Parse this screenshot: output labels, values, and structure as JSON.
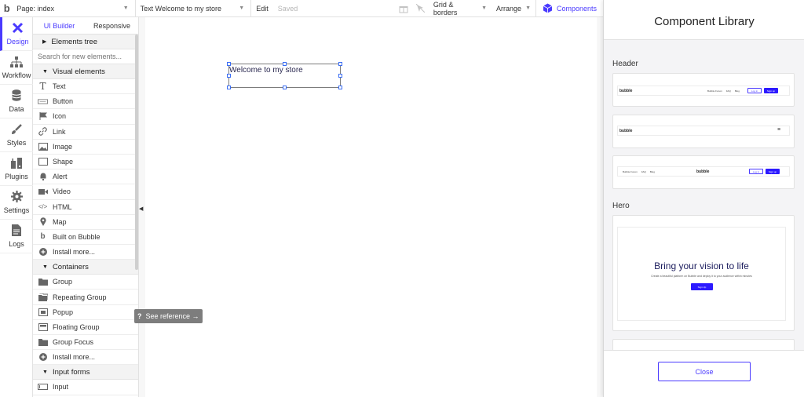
{
  "topbar": {
    "logo": "b",
    "page_selector": "Page: index",
    "element_selector": "Text Welcome to my store",
    "edit": "Edit",
    "saved": "Saved",
    "grid_borders": "Grid & borders",
    "arrange": "Arrange",
    "components": "Components"
  },
  "left_tabs": [
    {
      "label": "Design",
      "icon": "design-icon"
    },
    {
      "label": "Workflow",
      "icon": "workflow-icon"
    },
    {
      "label": "Data",
      "icon": "data-icon"
    },
    {
      "label": "Styles",
      "icon": "styles-icon"
    },
    {
      "label": "Plugins",
      "icon": "plugins-icon"
    },
    {
      "label": "Settings",
      "icon": "settings-icon"
    },
    {
      "label": "Logs",
      "icon": "logs-icon"
    }
  ],
  "panel": {
    "tabs": [
      "UI Builder",
      "Responsive"
    ],
    "elements_tree": "Elements tree",
    "search_placeholder": "Search for new elements...",
    "visual_elements": "Visual elements",
    "visual_items": [
      "Text",
      "Button",
      "Icon",
      "Link",
      "Image",
      "Shape",
      "Alert",
      "Video",
      "HTML",
      "Map",
      "Built on Bubble",
      "Install more..."
    ],
    "containers": "Containers",
    "container_items": [
      "Group",
      "Repeating Group",
      "Popup",
      "Floating Group",
      "Group Focus",
      "Install more..."
    ],
    "input_forms": "Input forms",
    "input_items": [
      "Input"
    ]
  },
  "canvas": {
    "text_element": "Welcome to my store"
  },
  "tooltip": {
    "q": "?",
    "text": "See reference →"
  },
  "library": {
    "title": "Component Library",
    "header_section": "Header",
    "hero_section": "Hero",
    "mini_logo": "bubble",
    "mini_links": [
      "Bubble Forum",
      "FAQ",
      "Blog"
    ],
    "mini_login": "Log in",
    "mini_signup": "Sign up",
    "hero_title": "Bring your vision to life",
    "hero_subtitle": "Create a beautiful platform on Bubble and deploy it to your audience within minutes",
    "hero_button": "Sign Up",
    "close": "Close"
  }
}
